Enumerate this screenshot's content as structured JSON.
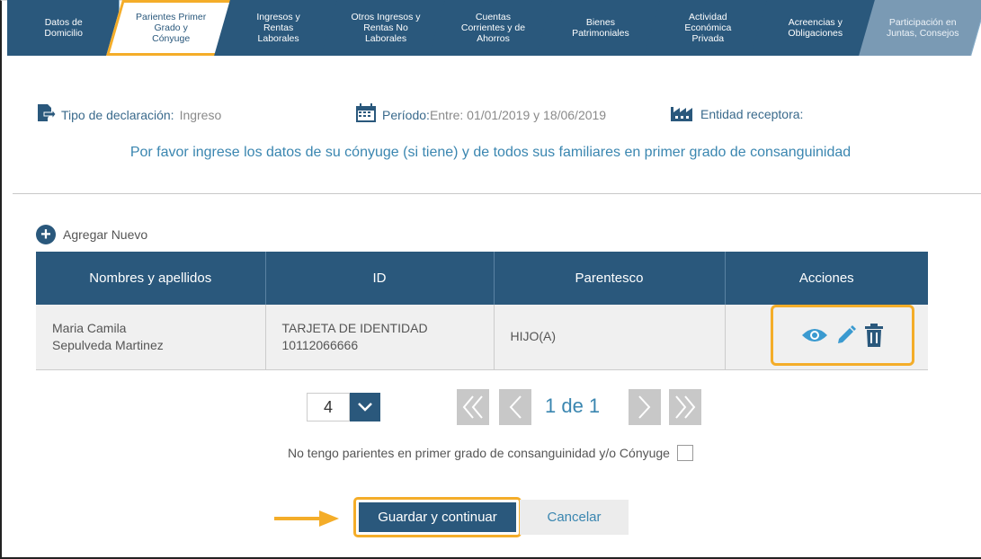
{
  "steps": [
    {
      "label": "Datos de\nDomicilio"
    },
    {
      "label": "Parientes Primer\nGrado y\nCónyuge"
    },
    {
      "label": "Ingresos y\nRentas\nLaborales"
    },
    {
      "label": "Otros Ingresos y\nRentas No\nLaborales"
    },
    {
      "label": "Cuentas\nCorrientes y de\nAhorros"
    },
    {
      "label": "Bienes\nPatrimoniales"
    },
    {
      "label": "Actividad\nEconómica\nPrivada"
    },
    {
      "label": "Acreencias y\nObligaciones"
    },
    {
      "label": "Participación en\nJuntas, Consejos"
    }
  ],
  "info": {
    "tipo_label": "Tipo de declaración:",
    "tipo_value": "Ingreso",
    "periodo_label": "Período:",
    "periodo_value": "Entre: 01/01/2019 y 18/06/2019",
    "entidad_label": "Entidad receptora:"
  },
  "instruction": "Por favor ingrese los datos de su cónyuge (si tiene) y de todos sus familiares en primer grado de consanguinidad",
  "add_new_label": "Agregar Nuevo",
  "table": {
    "headers": [
      "Nombres y apellidos",
      "ID",
      "Parentesco",
      "Acciones"
    ],
    "rows": [
      {
        "name_line1": "Maria Camila",
        "name_line2": "Sepulveda Martinez",
        "id_type": "TARJETA DE IDENTIDAD",
        "id_number": "10112066666",
        "parentesco": "HIJO(A)"
      }
    ]
  },
  "pager": {
    "page_size": "4",
    "page_info": "1 de 1"
  },
  "no_relatives_label": "No tengo parientes en primer grado de consanguinidad y/o Cónyuge",
  "buttons": {
    "save": "Guardar y continuar",
    "cancel": "Cancelar"
  },
  "colors": {
    "primary": "#2a587c",
    "highlight": "#f4ad29",
    "link": "#3a86b0"
  }
}
